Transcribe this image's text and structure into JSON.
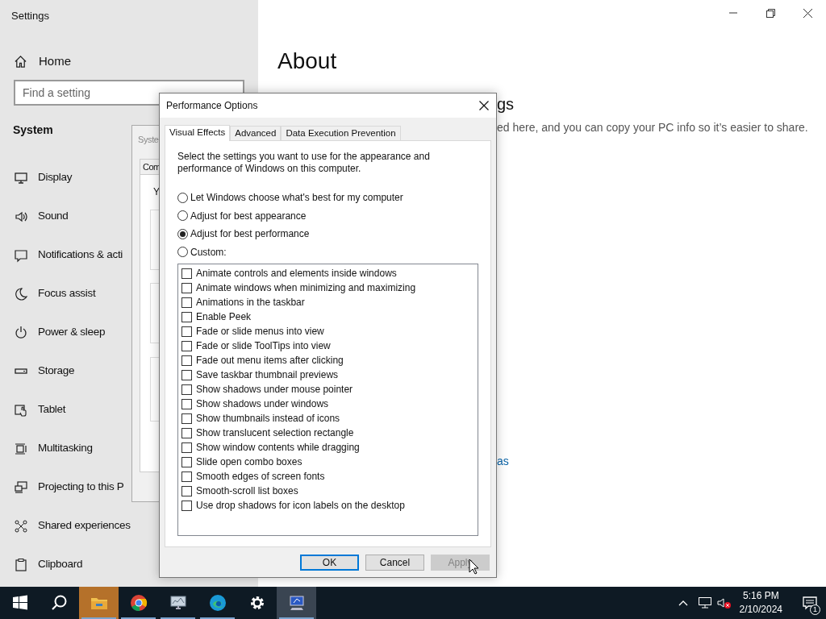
{
  "settings_window": {
    "title": "Settings",
    "home": "Home",
    "search": {
      "placeholder": "Find a setting"
    },
    "section": "System",
    "nav_items": [
      {
        "label": "Display"
      },
      {
        "label": "Sound"
      },
      {
        "label": "Notifications & acti"
      },
      {
        "label": "Focus assist"
      },
      {
        "label": "Power & sleep"
      },
      {
        "label": "Storage"
      },
      {
        "label": "Tablet"
      },
      {
        "label": "Multitasking"
      },
      {
        "label": "Projecting to this P"
      },
      {
        "label": "Shared experiences"
      },
      {
        "label": "Clipboard"
      }
    ],
    "page_title": "About",
    "heading_fragment": "gs",
    "description_fragment": "ed here, and you can copy your PC info so it’s easier to share.",
    "link_fragment": "as"
  },
  "background_window": {
    "title": "Syste",
    "tab": "Com",
    "text": "Y"
  },
  "dialog": {
    "title": "Performance Options",
    "tabs": [
      {
        "label": "Visual Effects",
        "selected": true
      },
      {
        "label": "Advanced",
        "selected": false
      },
      {
        "label": "Data Execution Prevention",
        "selected": false
      }
    ],
    "instruction": "Select the settings you want to use for the appearance and performance of Windows on this computer.",
    "options": [
      {
        "label": "Let Windows choose what's best for my computer",
        "selected": false
      },
      {
        "label": "Adjust for best appearance",
        "selected": false
      },
      {
        "label": "Adjust for best performance",
        "selected": true
      },
      {
        "label": "Custom:",
        "selected": false
      }
    ],
    "effects": [
      {
        "label": "Animate controls and elements inside windows",
        "checked": false
      },
      {
        "label": "Animate windows when minimizing and maximizing",
        "checked": false
      },
      {
        "label": "Animations in the taskbar",
        "checked": false
      },
      {
        "label": "Enable Peek",
        "checked": false
      },
      {
        "label": "Fade or slide menus into view",
        "checked": false
      },
      {
        "label": "Fade or slide ToolTips into view",
        "checked": false
      },
      {
        "label": "Fade out menu items after clicking",
        "checked": false
      },
      {
        "label": "Save taskbar thumbnail previews",
        "checked": false
      },
      {
        "label": "Show shadows under mouse pointer",
        "checked": false
      },
      {
        "label": "Show shadows under windows",
        "checked": false
      },
      {
        "label": "Show thumbnails instead of icons",
        "checked": false
      },
      {
        "label": "Show translucent selection rectangle",
        "checked": false
      },
      {
        "label": "Show window contents while dragging",
        "checked": false
      },
      {
        "label": "Slide open combo boxes",
        "checked": false
      },
      {
        "label": "Smooth edges of screen fonts",
        "checked": false
      },
      {
        "label": "Smooth-scroll list boxes",
        "checked": false
      },
      {
        "label": "Use drop shadows for icon labels on the desktop",
        "checked": false
      }
    ],
    "buttons": [
      {
        "label": "OK",
        "kind": "default"
      },
      {
        "label": "Cancel",
        "kind": "normal"
      },
      {
        "label": "Apply",
        "kind": "disabled"
      }
    ]
  },
  "taskbar": {
    "apps": [
      {
        "kind": "start",
        "running": false,
        "highlighted": false
      },
      {
        "kind": "search",
        "running": false,
        "highlighted": false
      },
      {
        "kind": "explorer",
        "running": true,
        "highlighted": true
      },
      {
        "kind": "chrome",
        "running": true,
        "highlighted": false
      },
      {
        "kind": "monitor",
        "running": true,
        "highlighted": false
      },
      {
        "kind": "edge",
        "running": true,
        "highlighted": false
      },
      {
        "kind": "settings",
        "running": false,
        "highlighted": false
      },
      {
        "kind": "sysprops",
        "running": true,
        "highlighted": true
      }
    ],
    "time": "5:16 PM",
    "date": "2/10/2024",
    "notification_count": "1"
  }
}
